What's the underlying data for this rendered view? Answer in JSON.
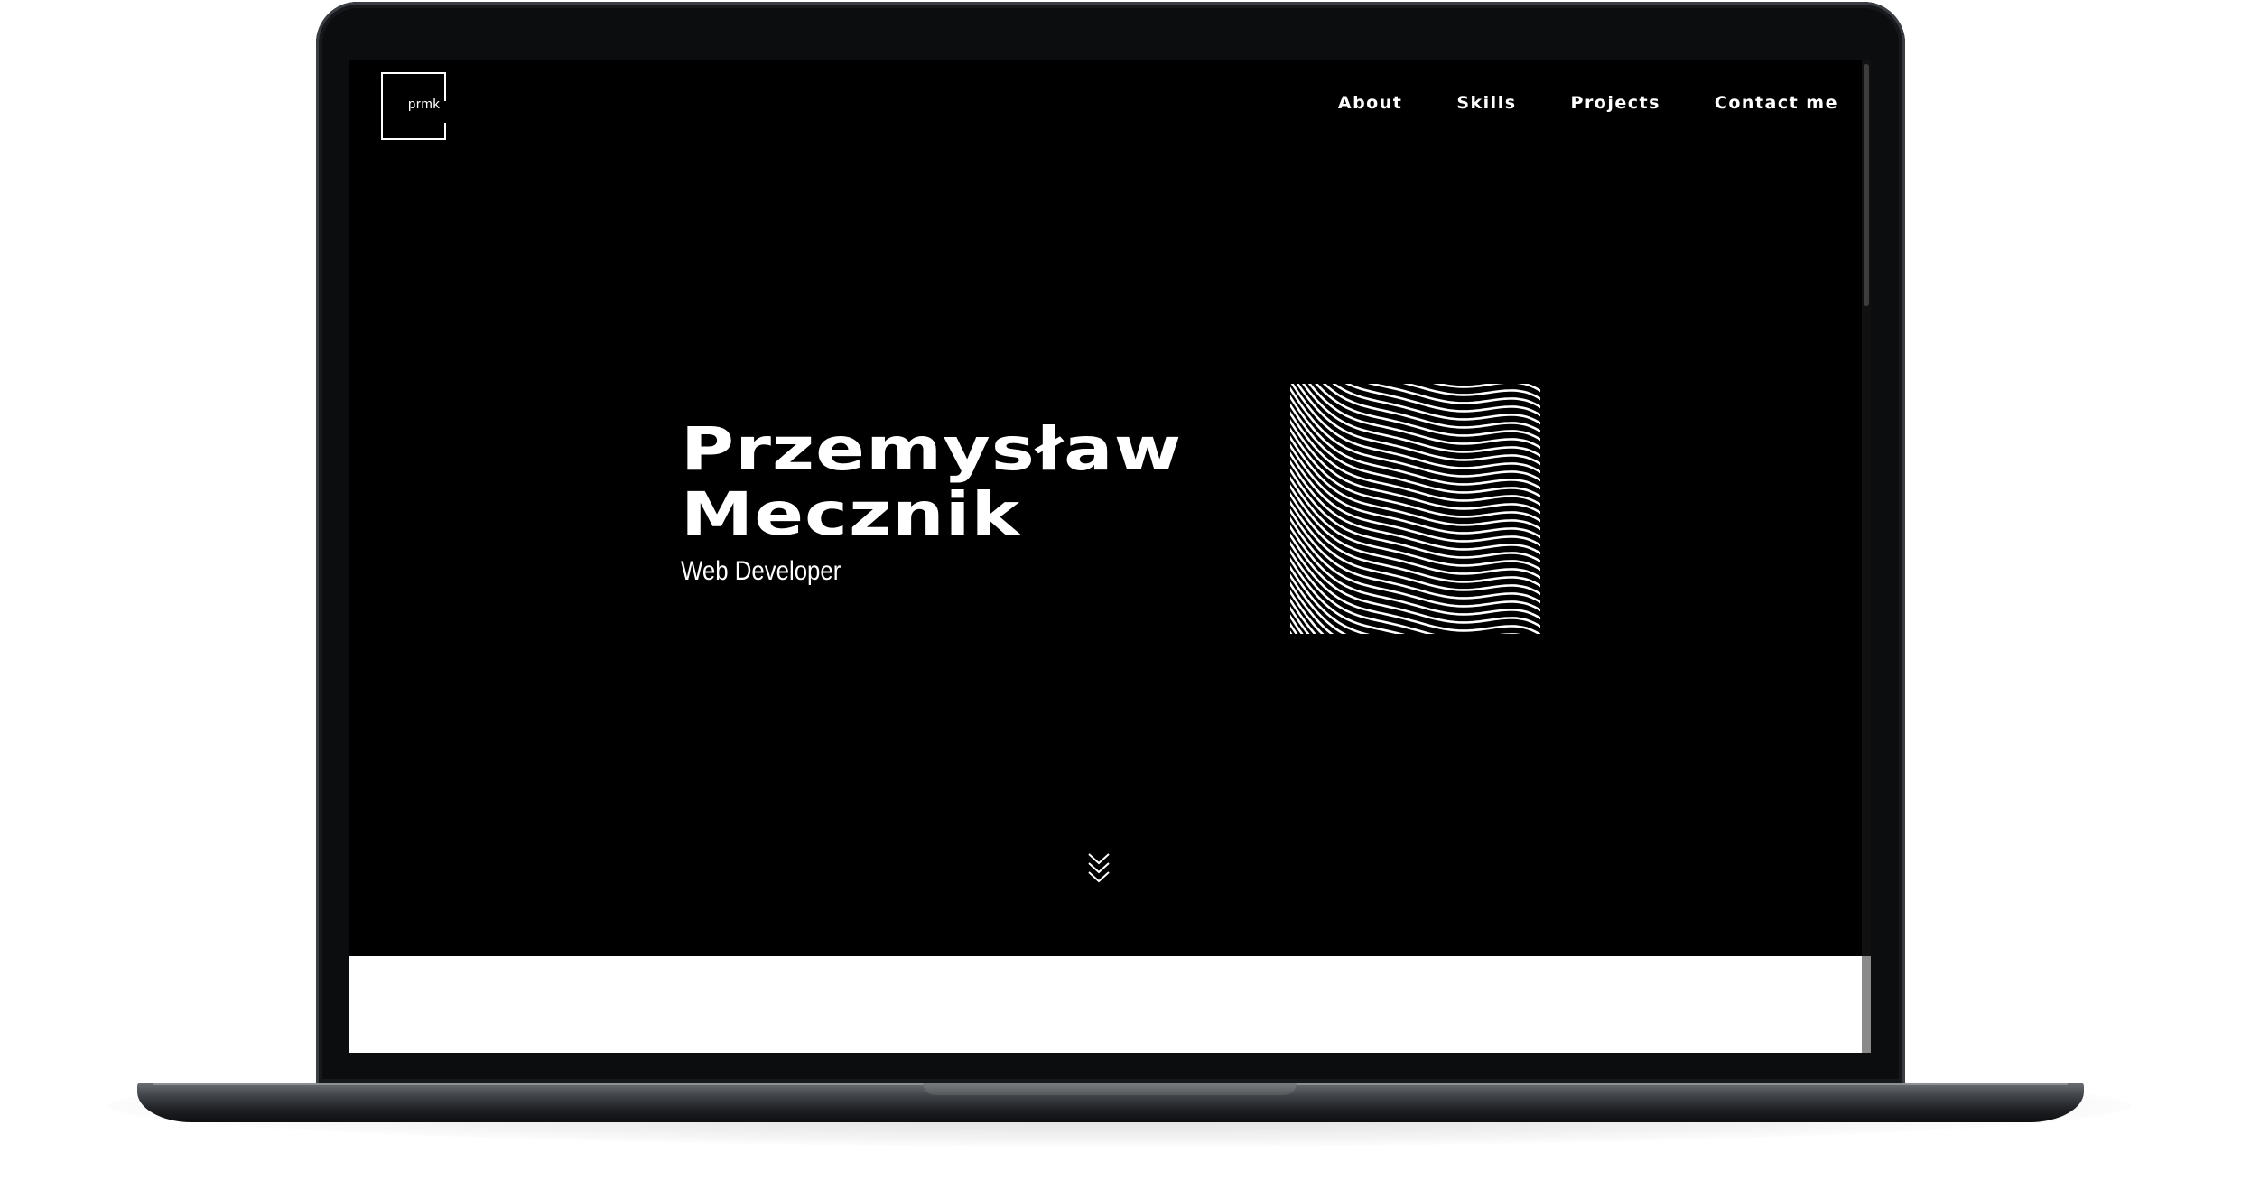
{
  "site": {
    "logo_text": "prmk",
    "nav": [
      {
        "label": "About"
      },
      {
        "label": "Skills"
      },
      {
        "label": "Projects"
      },
      {
        "label": "Contact me"
      }
    ]
  },
  "hero": {
    "name_line1": "Przemysław",
    "name_line2": "Mecznik",
    "subtitle": "Web Developer"
  },
  "icons": {
    "logo": "square-frame-logo",
    "hero_art": "wave-lines-art",
    "scroll": "double-chevron-down-icon"
  },
  "colors": {
    "background": "#000000",
    "text": "#ffffff",
    "device": "#0b0d0f"
  }
}
